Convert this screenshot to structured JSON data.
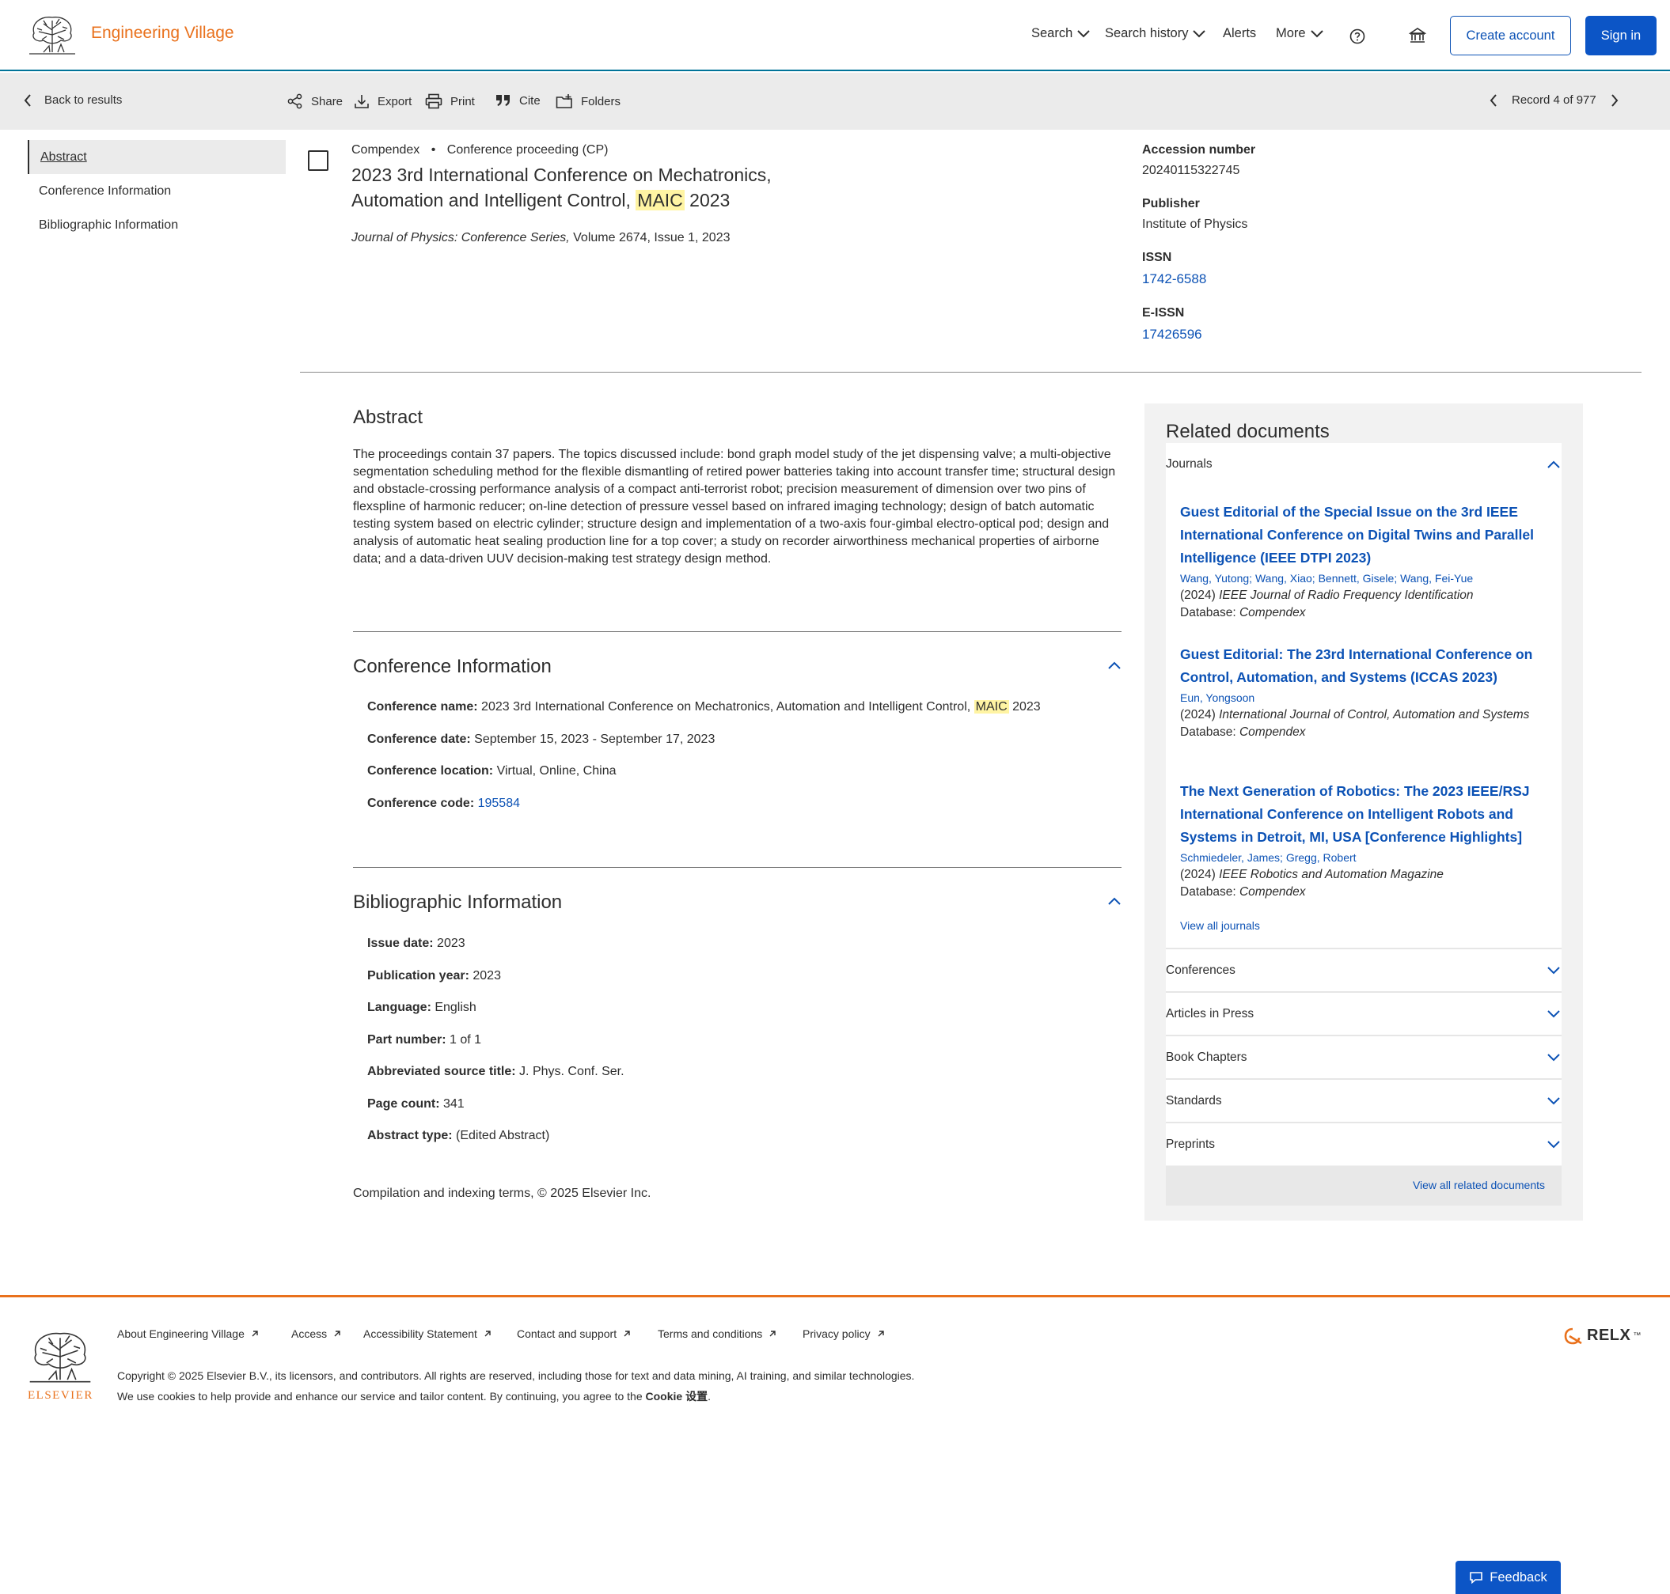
{
  "header": {
    "brand": "Engineering Village",
    "nav": {
      "search": "Search",
      "search_history": "Search history",
      "alerts": "Alerts",
      "more": "More"
    },
    "create_account": "Create account",
    "sign_in": "Sign in"
  },
  "toolbar": {
    "back": "Back to results",
    "share": "Share",
    "export": "Export",
    "print": "Print",
    "cite": "Cite",
    "folders": "Folders",
    "record_position": "Record 4 of 977"
  },
  "left_nav": [
    "Abstract",
    "Conference Information",
    "Bibliographic Information"
  ],
  "record": {
    "database": "Compendex",
    "separator": "•",
    "doc_type": "Conference proceeding (CP)",
    "title_part1": "2023 3rd International Conference on Mechatronics, Automation and Intelligent Control, ",
    "title_highlight": "MAIC",
    "title_part2": " 2023",
    "source_italic": "Journal of Physics: Conference Series,",
    "source_rest": " Volume 2674, Issue 1, 2023"
  },
  "right_meta": {
    "accession_label": "Accession number",
    "accession_value": "20240115322745",
    "publisher_label": "Publisher",
    "publisher_value": "Institute of Physics",
    "issn_label": "ISSN",
    "issn_value": "1742-6588",
    "eissn_label": "E-ISSN",
    "eissn_value": "17426596"
  },
  "abstract": {
    "heading": "Abstract",
    "text": "The proceedings contain 37 papers. The topics discussed include: bond graph model study of the jet dispensing valve; a multi-objective segmentation scheduling method for the flexible dismantling of retired power batteries taking into account transfer time; structural design and obstacle-crossing performance analysis of a compact anti-terrorist robot; precision measurement of dimension over two pins of flexspline of harmonic reducer; on-line detection of pressure vessel based on infrared imaging technology; design of batch automatic testing system based on electric cylinder; structure design and implementation of a two-axis four-gimbal electro-optical pod; design and analysis of automatic heat sealing production line for a top cover; a study on recorder airworthiness mechanical properties of airborne data; and a data-driven UUV decision-making test strategy design method."
  },
  "conference": {
    "heading": "Conference Information",
    "name_label": "Conference name:",
    "name_part1": " 2023 3rd International Conference on Mechatronics, Automation and Intelligent Control, ",
    "name_highlight": "MAIC",
    "name_part2": " 2023",
    "date_label": "Conference date:",
    "date_value": " September 15, 2023 - September 17, 2023",
    "location_label": "Conference location:",
    "location_value": " Virtual, Online, China",
    "code_label": "Conference code:",
    "code_value": "195584"
  },
  "bibliographic": {
    "heading": "Bibliographic Information",
    "fields": [
      {
        "label": "Issue date:",
        "value": " 2023"
      },
      {
        "label": "Publication year:",
        "value": " 2023"
      },
      {
        "label": "Language:",
        "value": " English"
      },
      {
        "label": "Part number:",
        "value": " 1 of 1"
      },
      {
        "label": "Abbreviated source title:",
        "value": " J. Phys. Conf. Ser."
      },
      {
        "label": "Page count:",
        "value": " 341"
      },
      {
        "label": "Abstract type:",
        "value": " (Edited Abstract)"
      }
    ]
  },
  "compilation": "Compilation and indexing terms, © 2025 Elsevier Inc.",
  "related": {
    "heading": "Related documents",
    "journals_label": "Journals",
    "docs": [
      {
        "title": "Guest Editorial of the Special Issue on the 3rd IEEE International Conference on Digital Twins and Parallel Intelligence (IEEE DTPI 2023)",
        "authors": "Wang, Yutong; Wang, Xiao; Bennett, Gisele; Wang, Fei-Yue",
        "year": "(2024) ",
        "source": "IEEE Journal of Radio Frequency Identification",
        "db_label": "Database: ",
        "db": "Compendex"
      },
      {
        "title": "Guest Editorial: The 23rd International Conference on Control, Automation, and Systems (ICCAS 2023)",
        "authors": "Eun, Yongsoon",
        "year": "(2024) ",
        "source": "International Journal of Control, Automation and Systems",
        "db_label": "Database: ",
        "db": "Compendex"
      },
      {
        "title": "The Next Generation of Robotics: The 2023 IEEE/RSJ International Conference on Intelligent Robots and Systems in Detroit, MI, USA [Conference Highlights]",
        "authors": "Schmiedeler, James; Gregg, Robert",
        "year": "(2024) ",
        "source": "IEEE Robotics and Automation Magazine",
        "db_label": "Database: ",
        "db": "Compendex"
      }
    ],
    "view_all_journals": "View all journals",
    "accordions": [
      "Conferences",
      "Articles in Press",
      "Book Chapters",
      "Standards",
      "Preprints"
    ],
    "view_all": "View all related documents"
  },
  "footer": {
    "elsevier": "ELSEVIER",
    "links": [
      "About Engineering Village",
      "Access",
      "Accessibility Statement",
      "Contact and support",
      "Terms and conditions",
      "Privacy policy"
    ],
    "copyright": "Copyright © 2025 Elsevier B.V., its licensors, and contributors. All rights are reserved, including those for text and data mining, AI training, and similar technologies.",
    "cookie_prefix": "We use cookies to help provide and enhance our service and tailor content. By continuing, you agree to the ",
    "cookie_link": "Cookie 设置",
    "cookie_suffix": ".",
    "relx": "RELX",
    "relx_tm": "™"
  },
  "feedback": "Feedback",
  "colors": {
    "brand_orange": "#e9711c",
    "link_blue": "#0c52b5",
    "primary_blue": "#0c55c6",
    "highlight": "#fff4a3"
  }
}
